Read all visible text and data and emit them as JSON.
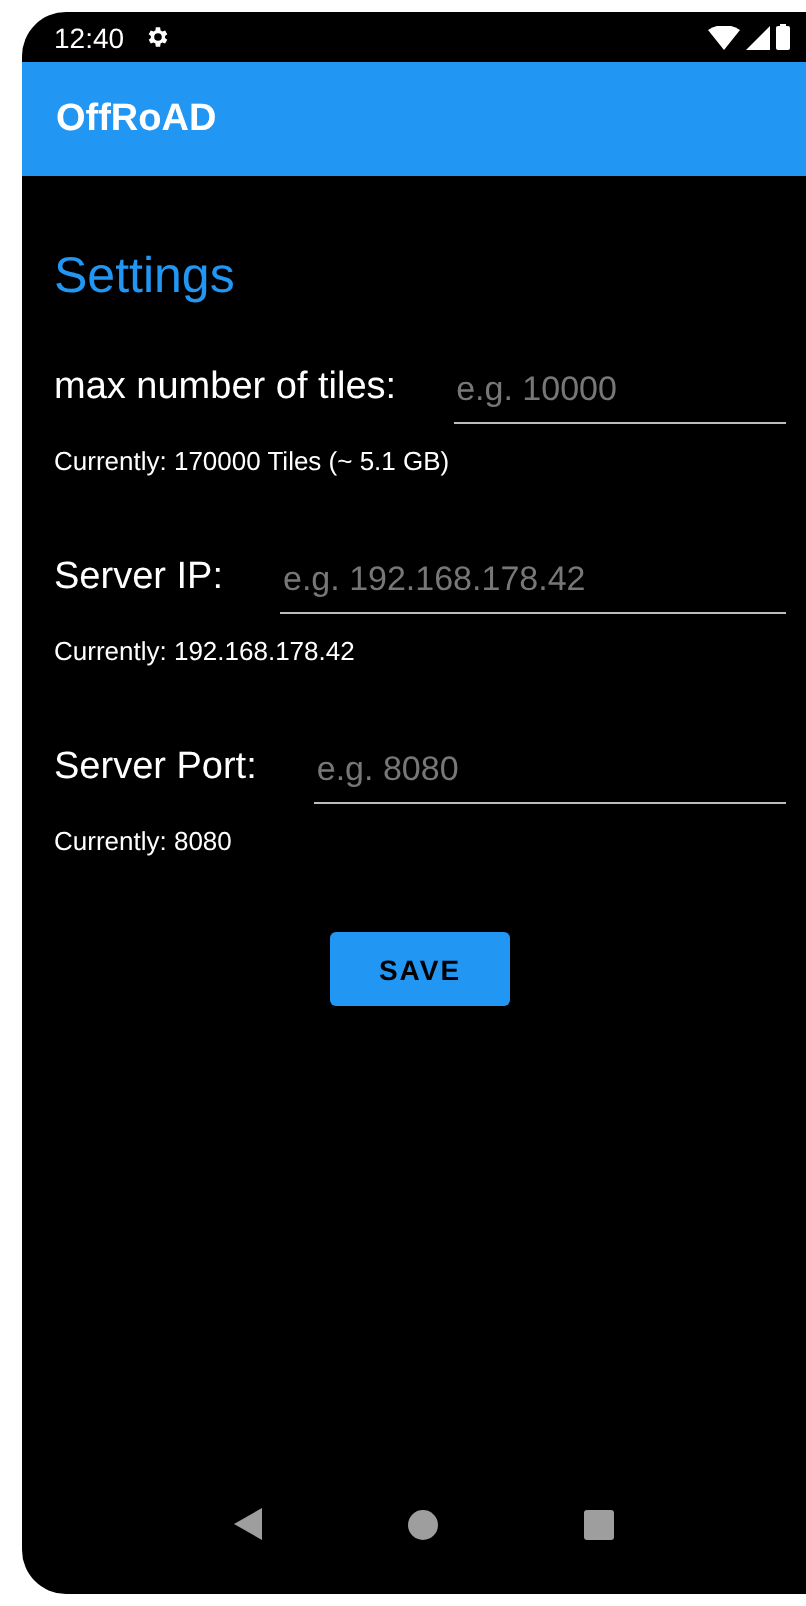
{
  "status_bar": {
    "time": "12:40"
  },
  "app_bar": {
    "title": "OffRoAD"
  },
  "page_title": "Settings",
  "settings": [
    {
      "label": "max number of tiles:",
      "placeholder": "e.g. 10000",
      "current": "Currently: 170000 Tiles (~ 5.1 GB)"
    },
    {
      "label": "Server IP:",
      "placeholder": "e.g. 192.168.178.42",
      "current": "Currently: 192.168.178.42"
    },
    {
      "label": "Server Port:",
      "placeholder": "e.g. 8080",
      "current": "Currently: 8080"
    }
  ],
  "save_button": "SAVE"
}
